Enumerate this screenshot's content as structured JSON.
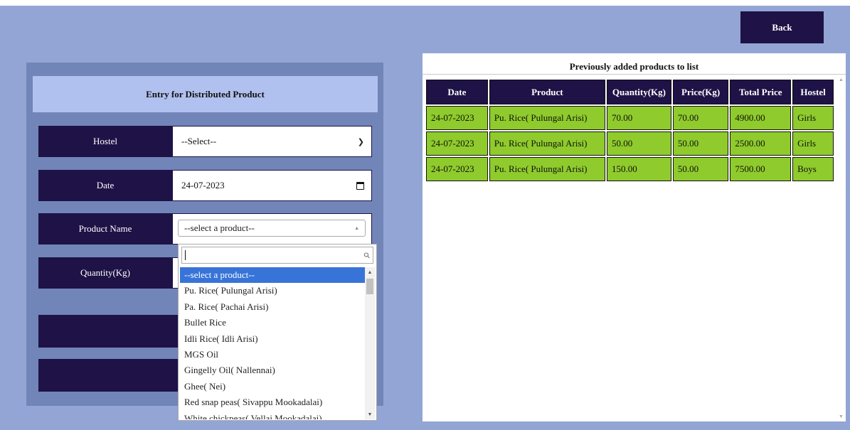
{
  "header": {
    "back_label": "Back"
  },
  "form": {
    "title": "Entry for Distributed Product",
    "hostel_label": "Hostel",
    "hostel_value": "--Select--",
    "date_label": "Date",
    "date_value": "24-07-2023",
    "product_label": "Product Name",
    "product_value": "--select a product--",
    "quantity_label": "Quantity(Kg)"
  },
  "dropdown": {
    "search_value": "",
    "options": [
      "--select a product--",
      "Pu. Rice( Pulungal Arisi)",
      "Pa. Rice( Pachai Arisi)",
      "Bullet Rice",
      "Idli Rice( Idli Arisi)",
      "MGS Oil",
      "Gingelly Oil( Nallennai)",
      "Ghee( Nei)",
      "Red snap peas( Sivappu Mookadalai)",
      "White chickpeas( Vellai Mookadalai)"
    ],
    "selected_index": 0
  },
  "table": {
    "title": "Previously added products to list",
    "columns": [
      "Date",
      "Product",
      "Quantity(Kg)",
      "Price(Kg)",
      "Total Price",
      "Hostel"
    ],
    "rows": [
      [
        "24-07-2023",
        "Pu. Rice( Pulungal Arisi)",
        "70.00",
        "70.00",
        "4900.00",
        "Girls"
      ],
      [
        "24-07-2023",
        "Pu. Rice( Pulungal Arisi)",
        "50.00",
        "50.00",
        "2500.00",
        "Girls"
      ],
      [
        "24-07-2023",
        "Pu. Rice( Pulungal Arisi)",
        "150.00",
        "50.00",
        "7500.00",
        "Boys"
      ]
    ]
  },
  "colors": {
    "page_bg": "#93a5d4",
    "panel_bg": "#7185b8",
    "header_bg": "#b1c1ef",
    "dark": "#1e1246",
    "row_green": "#8fcb2c",
    "highlight": "#3874d8"
  }
}
